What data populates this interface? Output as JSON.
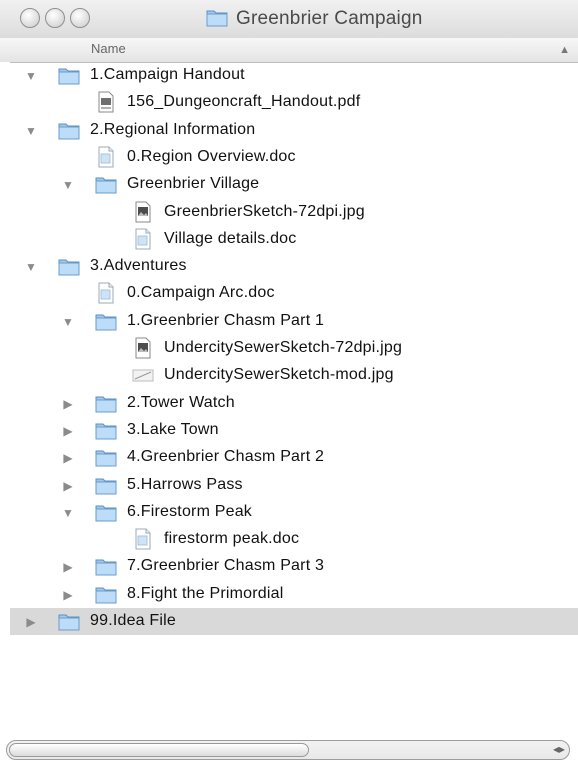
{
  "window": {
    "title": "Greenbrier Campaign"
  },
  "header": {
    "name_label": "Name",
    "sort_arrow": "▲"
  },
  "rows": [
    {
      "label": "1.Campaign Handout",
      "type": "folder",
      "expanded": true,
      "icon": "folder-icon"
    },
    {
      "label": "156_Dungeoncraft_Handout.pdf",
      "type": "file",
      "icon": "pdf-file-icon"
    },
    {
      "label": "2.Regional Information",
      "type": "folder",
      "expanded": true,
      "icon": "folder-icon"
    },
    {
      "label": "0.Region Overview.doc",
      "type": "file",
      "icon": "doc-file-icon"
    },
    {
      "label": "Greenbrier Village",
      "type": "folder",
      "expanded": true,
      "icon": "folder-icon"
    },
    {
      "label": "GreenbrierSketch-72dpi.jpg",
      "type": "file",
      "icon": "image-file-icon"
    },
    {
      "label": "Village details.doc",
      "type": "file",
      "icon": "doc-file-icon"
    },
    {
      "label": "3.Adventures",
      "type": "folder",
      "expanded": true,
      "icon": "folder-icon"
    },
    {
      "label": "0.Campaign Arc.doc",
      "type": "file",
      "icon": "doc-file-icon"
    },
    {
      "label": "1.Greenbrier Chasm Part 1",
      "type": "folder",
      "expanded": true,
      "icon": "folder-icon"
    },
    {
      "label": "UndercitySewerSketch-72dpi.jpg",
      "type": "file",
      "icon": "image-file-icon"
    },
    {
      "label": "UndercitySewerSketch-mod.jpg",
      "type": "file",
      "icon": "image-thumb-icon"
    },
    {
      "label": "2.Tower Watch",
      "type": "folder",
      "expanded": false,
      "icon": "folder-icon"
    },
    {
      "label": "3.Lake Town",
      "type": "folder",
      "expanded": false,
      "icon": "folder-icon"
    },
    {
      "label": "4.Greenbrier Chasm Part 2",
      "type": "folder",
      "expanded": false,
      "icon": "folder-icon"
    },
    {
      "label": "5.Harrows Pass",
      "type": "folder",
      "expanded": false,
      "icon": "folder-icon"
    },
    {
      "label": "6.Firestorm Peak",
      "type": "folder",
      "expanded": true,
      "icon": "folder-icon"
    },
    {
      "label": "firestorm peak.doc",
      "type": "file",
      "icon": "doc-file-icon"
    },
    {
      "label": "7.Greenbrier Chasm Part 3",
      "type": "folder",
      "expanded": false,
      "icon": "folder-icon"
    },
    {
      "label": "8.Fight the Primordial",
      "type": "folder",
      "expanded": false,
      "icon": "folder-icon"
    },
    {
      "label": "99.Idea File",
      "type": "folder",
      "expanded": false,
      "icon": "folder-icon",
      "selected": true
    }
  ]
}
